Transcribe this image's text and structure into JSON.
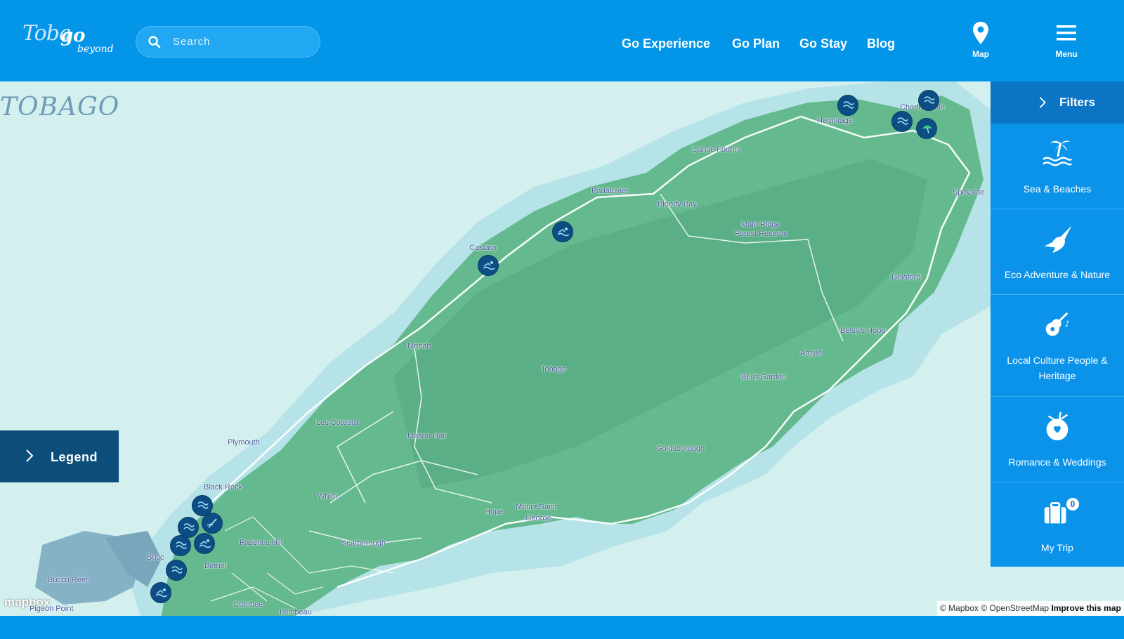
{
  "header": {
    "logo": {
      "part1": "Toba",
      "part2": "go",
      "part3": "beyond"
    },
    "search": {
      "placeholder": "Search"
    },
    "nav": [
      {
        "label": "Go Experience"
      },
      {
        "label": "Go Plan"
      },
      {
        "label": "Go Stay"
      },
      {
        "label": "Blog"
      }
    ],
    "map_button": {
      "label": "Map",
      "icon": "map-pin-icon"
    },
    "menu_button": {
      "label": "Menu",
      "icon": "hamburger-menu-icon"
    }
  },
  "map": {
    "title": "TOBAGO",
    "colors": {
      "sea": "#d3f0ef",
      "land": "#5fb88a",
      "shallow": "#b6e3e8",
      "road": "#ffffff"
    },
    "place_labels": [
      {
        "name": "Hermitage"
      },
      {
        "name": "Charlotteville"
      },
      {
        "name": "L'anse Fourmi"
      },
      {
        "name": "Parlatuvier"
      },
      {
        "name": "Bloody Bay"
      },
      {
        "name": "Main Ridge"
      },
      {
        "name": "Forest Reserve"
      },
      {
        "name": "Speyside"
      },
      {
        "name": "Castara"
      },
      {
        "name": "Delaford"
      },
      {
        "name": "Betsy's Hope"
      },
      {
        "name": "Argyle"
      },
      {
        "name": "Moriah"
      },
      {
        "name": "Tobago"
      },
      {
        "name": "Bella Garden"
      },
      {
        "name": "Les Coteaux"
      },
      {
        "name": "Mason Hall"
      },
      {
        "name": "Plymouth"
      },
      {
        "name": "Goldsborough"
      },
      {
        "name": "Black Rock"
      },
      {
        "name": "Whim"
      },
      {
        "name": "Mount Saint"
      },
      {
        "name": "George"
      },
      {
        "name": "Hope"
      },
      {
        "name": "Patience Hill"
      },
      {
        "name": "Scarborough"
      },
      {
        "name": "Bethel"
      },
      {
        "name": "Bucco Reef"
      },
      {
        "name": "Pigeon Point"
      },
      {
        "name": "Carnbee"
      },
      {
        "name": "Lambeau"
      },
      {
        "name": "Bucc"
      }
    ],
    "markers": [
      {
        "icon": "snorkel-icon"
      },
      {
        "icon": "snorkel-icon"
      },
      {
        "icon": "snorkel-icon"
      },
      {
        "icon": "beach-umbrella-icon"
      },
      {
        "icon": "swimmer-icon"
      },
      {
        "icon": "swimmer-icon"
      },
      {
        "icon": "snorkel-icon"
      },
      {
        "icon": "surf-icon"
      },
      {
        "icon": "snorkel-icon"
      },
      {
        "icon": "swimmer-icon"
      },
      {
        "icon": "snorkel-icon"
      },
      {
        "icon": "snorkel-icon"
      },
      {
        "icon": "swimmer-icon"
      }
    ],
    "legend": {
      "label": "Legend"
    },
    "attribution": {
      "mapbox": "© Mapbox",
      "osm": "© OpenStreetMap",
      "improve": "Improve this map"
    },
    "mapbox_logo": "mapbox"
  },
  "filters": {
    "title": "Filters",
    "items": [
      {
        "label": "Sea & Beaches",
        "icon": "palm-tree-waves-icon"
      },
      {
        "label": "Eco Adventure & Nature",
        "icon": "hummingbird-icon"
      },
      {
        "label": "Local Culture People & Heritage",
        "icon": "guitar-music-icon"
      },
      {
        "label": "Romance & Weddings",
        "icon": "coconut-heart-icon"
      },
      {
        "label": "My Trip",
        "icon": "suitcase-icon",
        "badge": "0"
      }
    ]
  }
}
